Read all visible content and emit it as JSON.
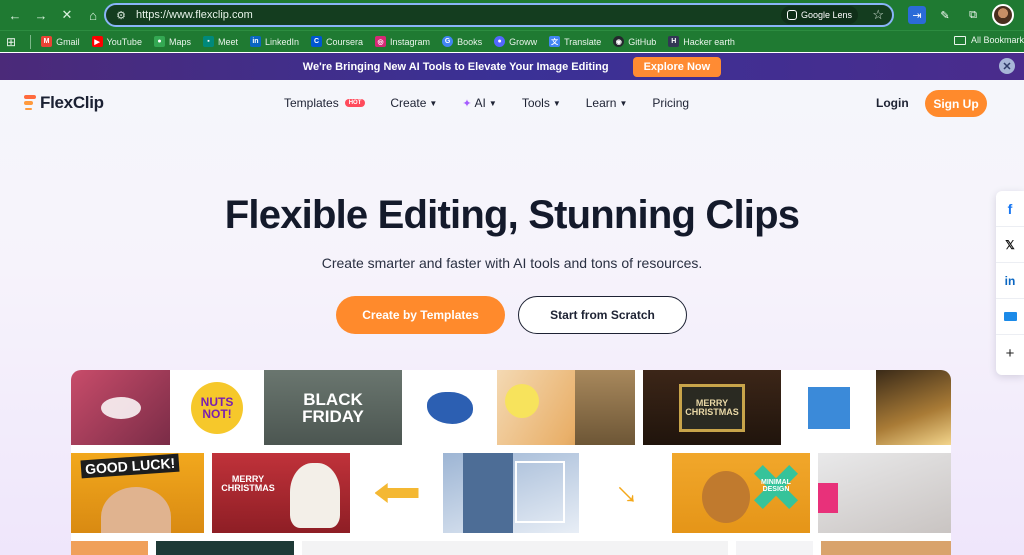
{
  "browser": {
    "url": "https://www.flexclip.com",
    "lens_label": "Google Lens",
    "bookmarks": [
      {
        "label": "Gmail",
        "icon": "gmail-icon",
        "color": "#ea4335"
      },
      {
        "label": "YouTube",
        "icon": "youtube-icon",
        "color": "#ff0000"
      },
      {
        "label": "Maps",
        "icon": "maps-icon",
        "color": "#34a853"
      },
      {
        "label": "Meet",
        "icon": "meet-icon",
        "color": "#00897b"
      },
      {
        "label": "LinkedIn",
        "icon": "linkedin-icon",
        "color": "#0a66c2"
      },
      {
        "label": "Coursera",
        "icon": "coursera-icon",
        "color": "#0056d2"
      },
      {
        "label": "Instagram",
        "icon": "instagram-icon",
        "color": "#d62976"
      },
      {
        "label": "Books",
        "icon": "google-icon",
        "color": "#4285f4"
      },
      {
        "label": "Groww",
        "icon": "groww-icon",
        "color": "#5367ff"
      },
      {
        "label": "Translate",
        "icon": "translate-icon",
        "color": "#4285f4"
      },
      {
        "label": "GitHub",
        "icon": "github-icon",
        "color": "#24292e"
      },
      {
        "label": "Hacker earth",
        "icon": "hackerearth-icon",
        "color": "#323754"
      }
    ],
    "all_bookmarks_label": "All Bookmark"
  },
  "promo": {
    "text": "We're Bringing New AI Tools to Elevate Your Image Editing",
    "button": "Explore Now"
  },
  "header": {
    "logo": "FlexClip",
    "nav": [
      {
        "label": "Templates",
        "badge": "HOT",
        "dropdown": false
      },
      {
        "label": "Create",
        "dropdown": true
      },
      {
        "label": "AI",
        "dropdown": true
      },
      {
        "label": "Tools",
        "dropdown": true
      },
      {
        "label": "Learn",
        "dropdown": true
      },
      {
        "label": "Pricing",
        "dropdown": false
      }
    ],
    "login": "Login",
    "signup": "Sign Up"
  },
  "hero": {
    "title": "Flexible Editing, Stunning Clips",
    "subtitle": "Create smarter and faster with AI tools and tons of resources.",
    "primary_cta": "Create by Templates",
    "secondary_cta": "Start from Scratch"
  },
  "share": [
    "facebook-icon",
    "x-icon",
    "linkedin-icon",
    "mail-icon",
    "plus-icon"
  ],
  "gallery": {
    "tile_texts": {
      "nuts": "NUTS NOT!",
      "black_friday": "BLACK FRIDAY",
      "merry_christmas": "MERRY CHRISTMAS",
      "good_luck": "GOOD LUCK!",
      "merry_christmas_2": "MERRY CHRISTMAS",
      "minimal_design": "MINIMAL DESIGN"
    }
  },
  "colors": {
    "accent": "#ff8a2c",
    "browser_chrome": "#1f7a32",
    "promo_bg": "#3a3196"
  }
}
